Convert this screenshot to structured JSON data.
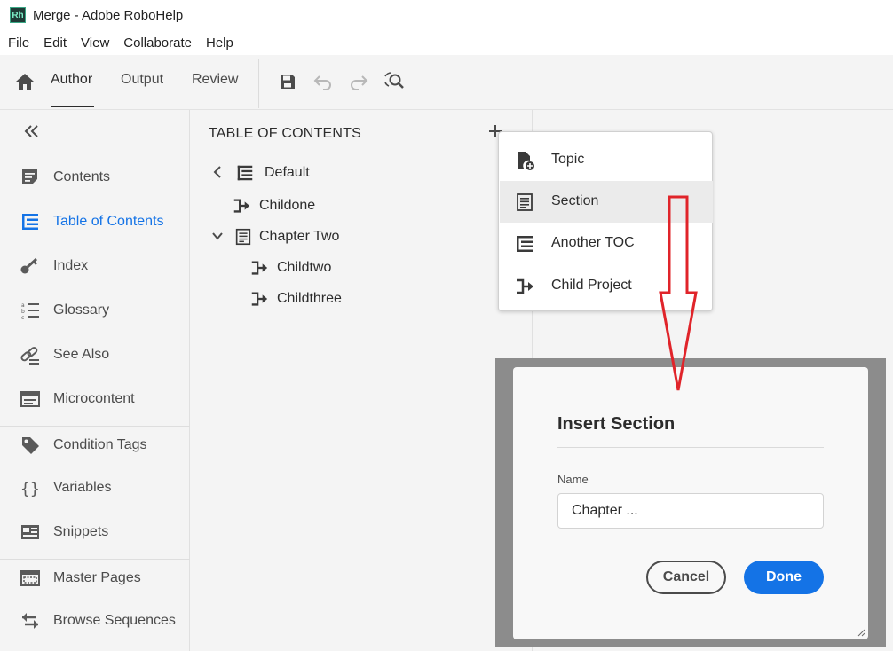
{
  "window": {
    "app_logo": "Rh",
    "title": "Merge - Adobe RoboHelp"
  },
  "menu": [
    "File",
    "Edit",
    "View",
    "Collaborate",
    "Help"
  ],
  "toolbar": {
    "tabs": [
      "Author",
      "Output",
      "Review"
    ],
    "active_tab": "Author",
    "icons": [
      "home-icon",
      "save-icon",
      "undo-icon",
      "redo-icon",
      "find-replace-icon"
    ]
  },
  "sidebar": {
    "items": [
      {
        "label": "Contents",
        "icon": "contents-icon"
      },
      {
        "label": "Table of Contents",
        "icon": "toc-icon",
        "active": true
      },
      {
        "label": "Index",
        "icon": "key-icon"
      },
      {
        "label": "Glossary",
        "icon": "glossary-icon"
      },
      {
        "label": "See Also",
        "icon": "see-also-icon"
      },
      {
        "label": "Microcontent",
        "icon": "microcontent-icon"
      },
      {
        "label": "Condition Tags",
        "icon": "tag-icon"
      },
      {
        "label": "Variables",
        "icon": "braces-icon"
      },
      {
        "label": "Snippets",
        "icon": "snippet-icon"
      },
      {
        "label": "Master Pages",
        "icon": "master-page-icon"
      },
      {
        "label": "Browse Sequences",
        "icon": "browse-sequence-icon"
      }
    ]
  },
  "toc": {
    "title": "TABLE OF CONTENTS",
    "tree": [
      {
        "label": "Default",
        "type": "toc",
        "expanded": false
      },
      {
        "label": "Childone",
        "type": "child-project"
      },
      {
        "label": "Chapter Two",
        "type": "section",
        "expanded": true
      },
      {
        "label": "Childtwo",
        "type": "child-project"
      },
      {
        "label": "Childthree",
        "type": "child-project"
      }
    ]
  },
  "dropdown": {
    "items": [
      {
        "label": "Topic",
        "icon": "topic-add-icon"
      },
      {
        "label": "Section",
        "icon": "section-icon",
        "highlighted": true
      },
      {
        "label": "Another TOC",
        "icon": "toc-icon"
      },
      {
        "label": "Child Project",
        "icon": "child-project-icon"
      }
    ]
  },
  "dialog": {
    "title": "Insert Section",
    "name_label": "Name",
    "name_value": "Chapter ...",
    "cancel_label": "Cancel",
    "done_label": "Done"
  },
  "colors": {
    "accent": "#1473e6",
    "panel_bg": "#f4f4f4",
    "annotation_arrow": "#e0242a"
  }
}
